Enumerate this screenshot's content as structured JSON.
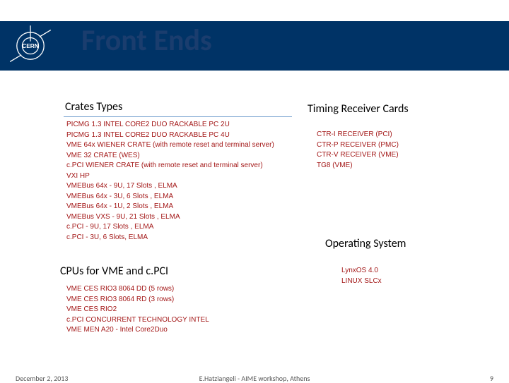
{
  "title": "Front Ends",
  "headings": {
    "crates": "Crates Types",
    "timing": "Timing Receiver Cards",
    "os": "Operating System",
    "cpus": "CPUs for VME and c.PCI"
  },
  "crates": [
    "PICMG 1.3 INTEL CORE2 DUO RACKABLE PC 2U",
    "PICMG 1.3 INTEL CORE2 DUO RACKABLE PC 4U",
    "VME 64x WIENER CRATE (with remote reset and terminal server)",
    "VME 32 CRATE (WES)",
    "c.PCI WIENER CRATE (with remote reset and terminal server)",
    "VXI HP",
    "VMEBus 64x - 9U, 17 Slots , ELMA",
    "VMEBus 64x - 3U, 6 Slots , ELMA",
    "VMEBus 64x - 1U, 2 Slots , ELMA",
    "VMEBus VXS - 9U, 21 Slots , ELMA",
    "c.PCI - 9U, 17 Slots , ELMA",
    "c.PCI - 3U, 6 Slots, ELMA"
  ],
  "timing": [
    "CTR-I RECEIVER (PCI)",
    "CTR-P RECEIVER (PMC)",
    "CTR-V RECEIVER (VME)",
    "TG8 (VME)"
  ],
  "cpus": [
    "VME CES RIO3 8064 DD (5 rows)",
    "VME CES RIO3 8064 RD (3 rows)",
    "VME CES RIO2",
    "c.PCI CONCURRENT TECHNOLOGY INTEL",
    "VME MEN A20 - Intel Core2Duo"
  ],
  "os": [
    "LynxOS 4.0",
    "LINUX SLCx"
  ],
  "footer": {
    "date": "December 2, 2013",
    "center": "E.Hatziangeli - AIME workshop, Athens",
    "page": "9"
  }
}
